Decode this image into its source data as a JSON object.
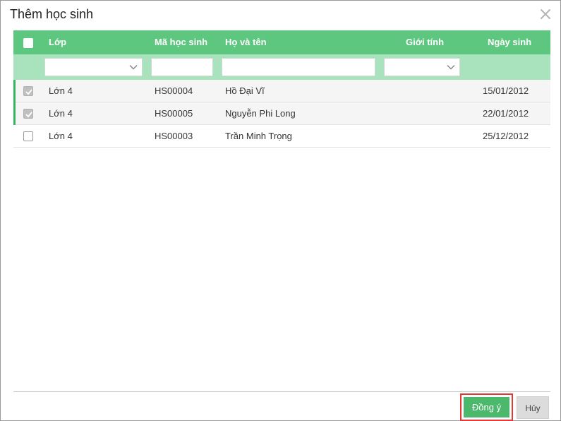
{
  "dialog": {
    "title": "Thêm học sinh",
    "close_icon": "close-icon"
  },
  "columns": {
    "class": "Lớp",
    "student_id": "Mã học sinh",
    "full_name": "Họ và tên",
    "gender": "Giới tính",
    "birthdate": "Ngày sinh"
  },
  "filters": {
    "class": "",
    "student_id": "",
    "full_name": "",
    "gender": ""
  },
  "rows": [
    {
      "checked": true,
      "class": "Lớn 4",
      "student_id": "HS00004",
      "full_name": "Hồ Đại Vĩ",
      "gender": "",
      "birthdate": "15/01/2012"
    },
    {
      "checked": true,
      "class": "Lớn 4",
      "student_id": "HS00005",
      "full_name": "Nguyễn Phi Long",
      "gender": "",
      "birthdate": "22/01/2012"
    },
    {
      "checked": false,
      "class": "Lớn 4",
      "student_id": "HS00003",
      "full_name": "Trần Minh Trọng",
      "gender": "",
      "birthdate": "25/12/2012"
    }
  ],
  "footer": {
    "ok_label": "Đồng ý",
    "cancel_label": "Hủy"
  },
  "colors": {
    "header_green": "#5ec77f",
    "filter_green": "#a9e3bd",
    "ok_button": "#4cb86b",
    "highlight_border": "#e53935"
  }
}
